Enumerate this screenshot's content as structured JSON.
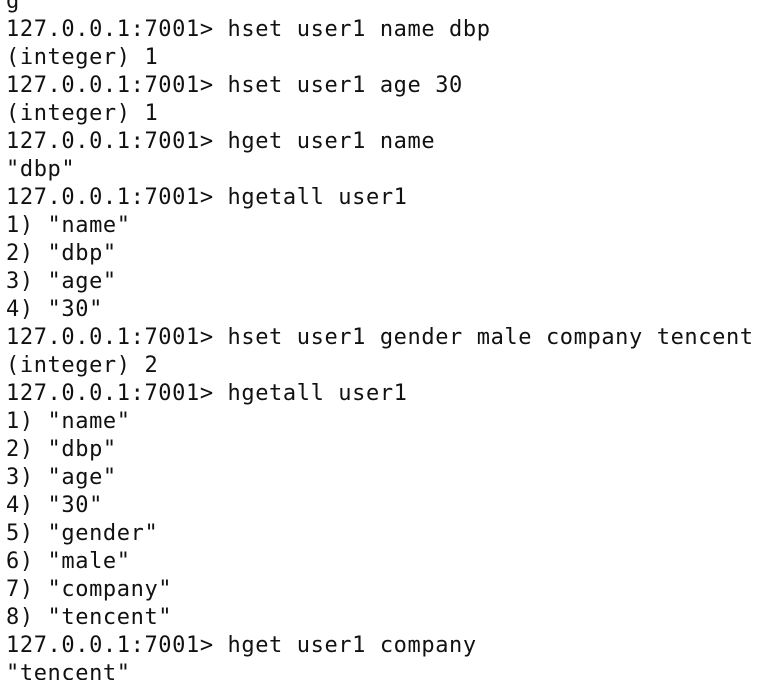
{
  "terminal": {
    "lines": [
      "g",
      "127.0.0.1:7001> hset user1 name dbp",
      "(integer) 1",
      "127.0.0.1:7001> hset user1 age 30",
      "(integer) 1",
      "127.0.0.1:7001> hget user1 name",
      "\"dbp\"",
      "127.0.0.1:7001> hgetall user1",
      "1) \"name\"",
      "2) \"dbp\"",
      "3) \"age\"",
      "4) \"30\"",
      "127.0.0.1:7001> hset user1 gender male company tencent",
      "(integer) 2",
      "127.0.0.1:7001> hgetall user1",
      "1) \"name\"",
      "2) \"dbp\"",
      "3) \"age\"",
      "4) \"30\"",
      "5) \"gender\"",
      "6) \"male\"",
      "7) \"company\"",
      "8) \"tencent\"",
      "127.0.0.1:7001> hget user1 company",
      "\"tencent\""
    ]
  }
}
